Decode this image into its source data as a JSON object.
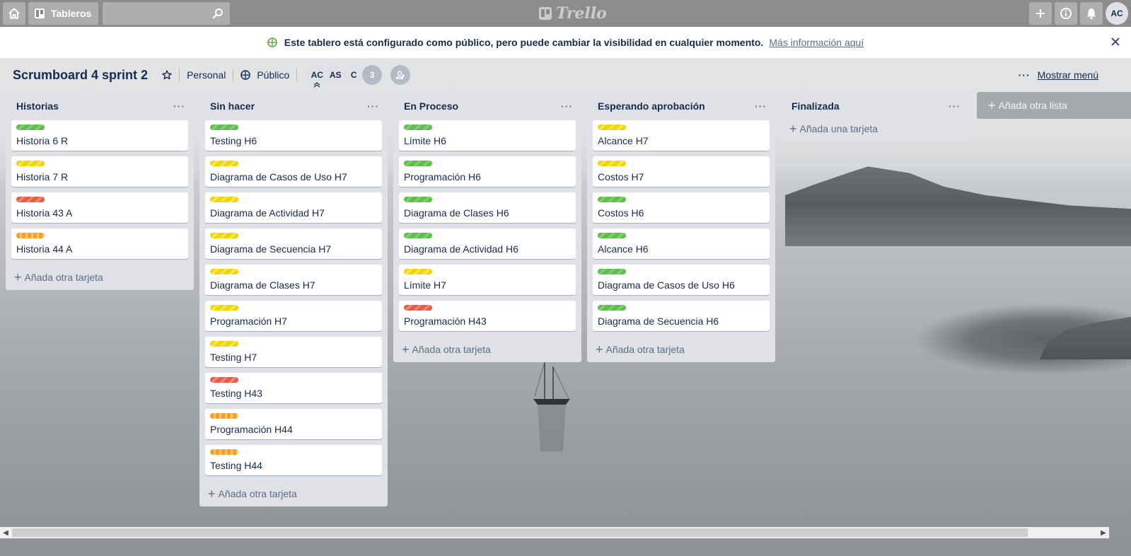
{
  "header": {
    "boards_label": "Tableros",
    "search_placeholder": "",
    "logo_text": "Trello",
    "user_initials": "AC"
  },
  "banner": {
    "message": "Este tablero está configurado como público, pero puede cambiar la visibilidad en cualquier momento.",
    "link": "Más información aquí"
  },
  "board": {
    "title": "Scrumboard 4 sprint 2",
    "team": "Personal",
    "visibility": "Público",
    "members": [
      "AC",
      "AS",
      "C"
    ],
    "extra_members": "3",
    "menu_label": "Mostrar menú",
    "menu_dots": "···"
  },
  "lists": [
    {
      "title": "Historias",
      "cards": [
        {
          "label": "green",
          "title": "Historia 6 R"
        },
        {
          "label": "yellow",
          "title": "Historia 7 R"
        },
        {
          "label": "red",
          "title": "Historia 43 A"
        },
        {
          "label": "orange",
          "title": "Historia 44 A"
        }
      ],
      "add_label": "Añada otra tarjeta"
    },
    {
      "title": "Sin hacer",
      "cards": [
        {
          "label": "green",
          "title": "Testing H6"
        },
        {
          "label": "yellow",
          "title": "Diagrama de Casos de Uso H7"
        },
        {
          "label": "yellow",
          "title": "Diagrama de Actividad H7"
        },
        {
          "label": "yellow",
          "title": "Diagrama de Secuencia H7"
        },
        {
          "label": "yellow",
          "title": "Diagrama de Clases H7"
        },
        {
          "label": "yellow",
          "title": "Programación H7"
        },
        {
          "label": "yellow",
          "title": "Testing H7"
        },
        {
          "label": "red",
          "title": "Testing H43"
        },
        {
          "label": "orange",
          "title": "Programación H44"
        },
        {
          "label": "orange",
          "title": "Testing H44"
        }
      ],
      "add_label": "Añada otra tarjeta"
    },
    {
      "title": "En Proceso",
      "cards": [
        {
          "label": "green",
          "title": "Límite H6"
        },
        {
          "label": "green",
          "title": "Programación H6"
        },
        {
          "label": "green",
          "title": "Diagrama de Clases H6"
        },
        {
          "label": "green",
          "title": "Diagrama de Actividad H6"
        },
        {
          "label": "yellow",
          "title": "Límite H7"
        },
        {
          "label": "red",
          "title": "Programación H43"
        }
      ],
      "add_label": "Añada otra tarjeta"
    },
    {
      "title": "Esperando aprobación",
      "cards": [
        {
          "label": "yellow",
          "title": "Alcance H7"
        },
        {
          "label": "yellow",
          "title": "Costos H7"
        },
        {
          "label": "green",
          "title": "Costos H6"
        },
        {
          "label": "green",
          "title": "Alcance H6"
        },
        {
          "label": "green",
          "title": "Diagrama de Casos de Uso H6"
        },
        {
          "label": "green",
          "title": "Diagrama de Secuencia H6"
        }
      ],
      "add_label": "Añada otra tarjeta"
    },
    {
      "title": "Finalizada",
      "cards": [],
      "add_label": "Añada una tarjeta"
    }
  ],
  "add_list_label": "Añada otra lista",
  "list_menu_dots": "···",
  "colors": {
    "green": "#61bd4f",
    "yellow": "#f2d600",
    "red": "#eb5a46",
    "orange": "#ff9f1a",
    "banner_icon": "#5aac44"
  },
  "icons": {
    "home": "home-icon",
    "boards": "boards-icon",
    "search": "search-icon",
    "create": "plus-icon",
    "info": "info-icon",
    "notifications": "bell-icon",
    "star": "star-icon",
    "visibility": "globe-icon",
    "invite": "add-member-icon",
    "close": "close-icon"
  }
}
